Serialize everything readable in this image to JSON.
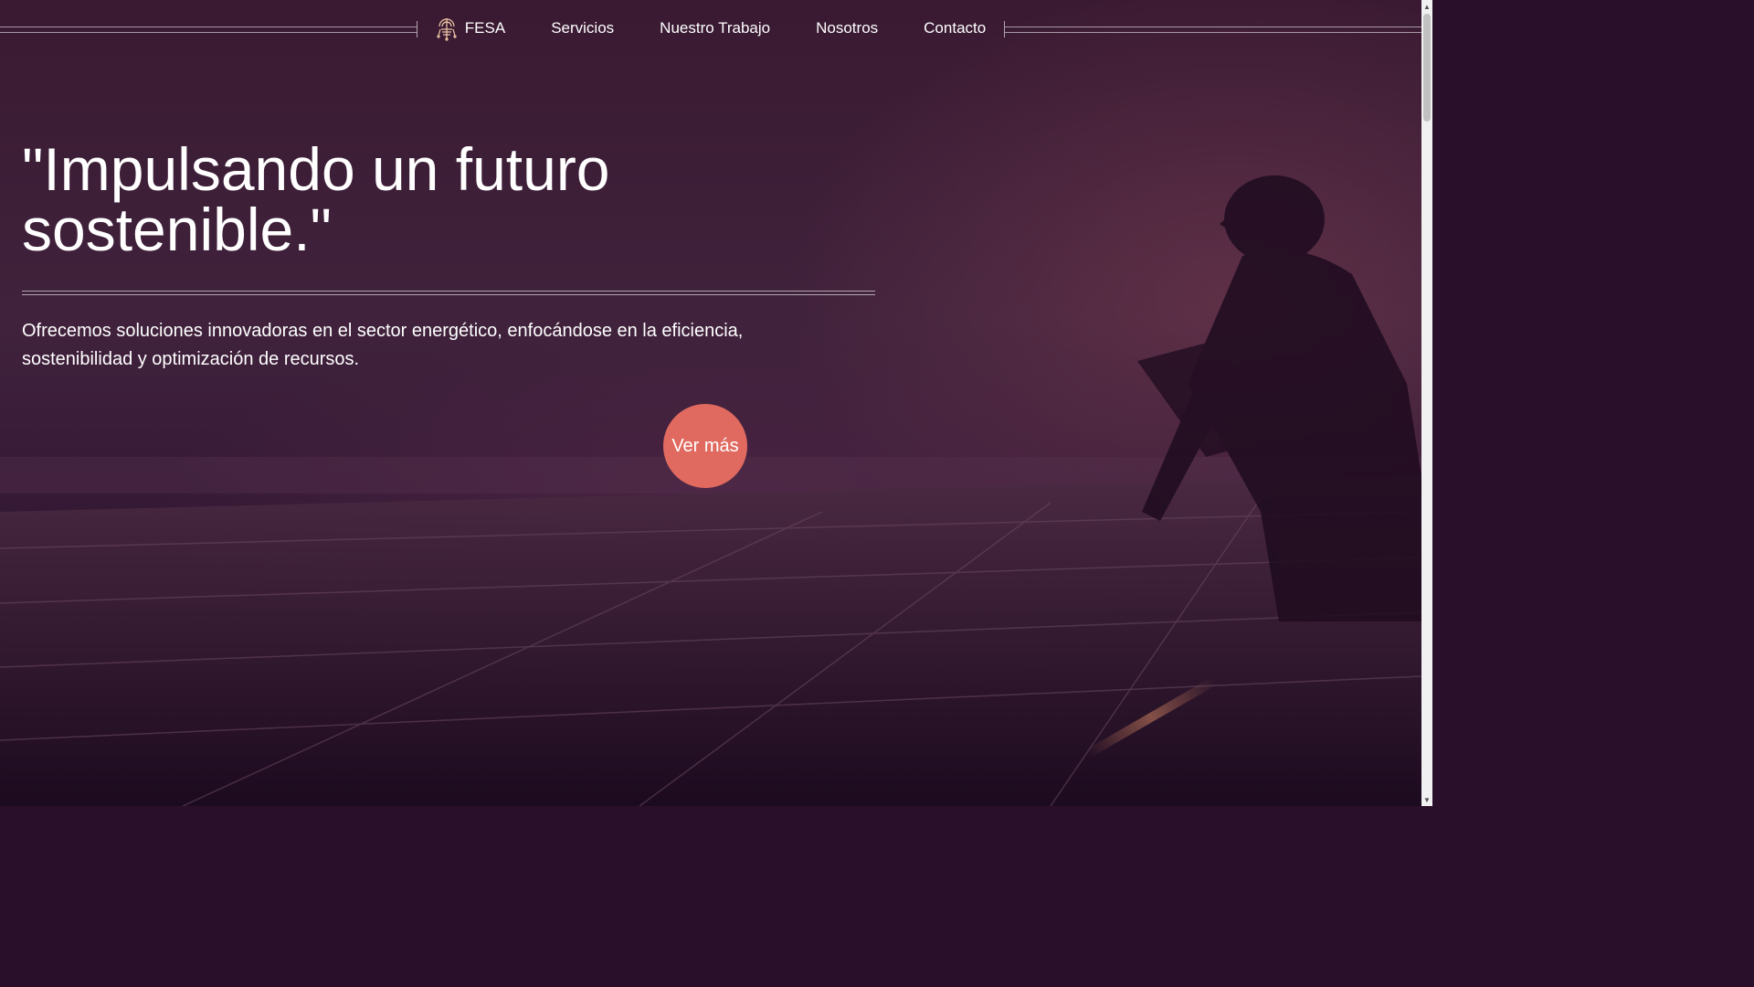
{
  "nav": {
    "brand": "FESA",
    "brand_icon": "circuit-tree-icon",
    "items": [
      {
        "label": "Servicios"
      },
      {
        "label": "Nuestro Trabajo"
      },
      {
        "label": "Nosotros"
      },
      {
        "label": "Contacto"
      }
    ]
  },
  "hero": {
    "headline": "\"Impulsando un futuro sostenible.\"",
    "description": "Ofrecemos soluciones innovadoras en el sector energético, enfocándose en la eficiencia, sostenibilidad y optimización de recursos.",
    "cta_label": "Ver más",
    "background_image": "worker-silhouette-solar-panels"
  },
  "colors": {
    "accent": "#e06a60",
    "overlay": "#2a0f2a",
    "text": "#ffffff"
  }
}
